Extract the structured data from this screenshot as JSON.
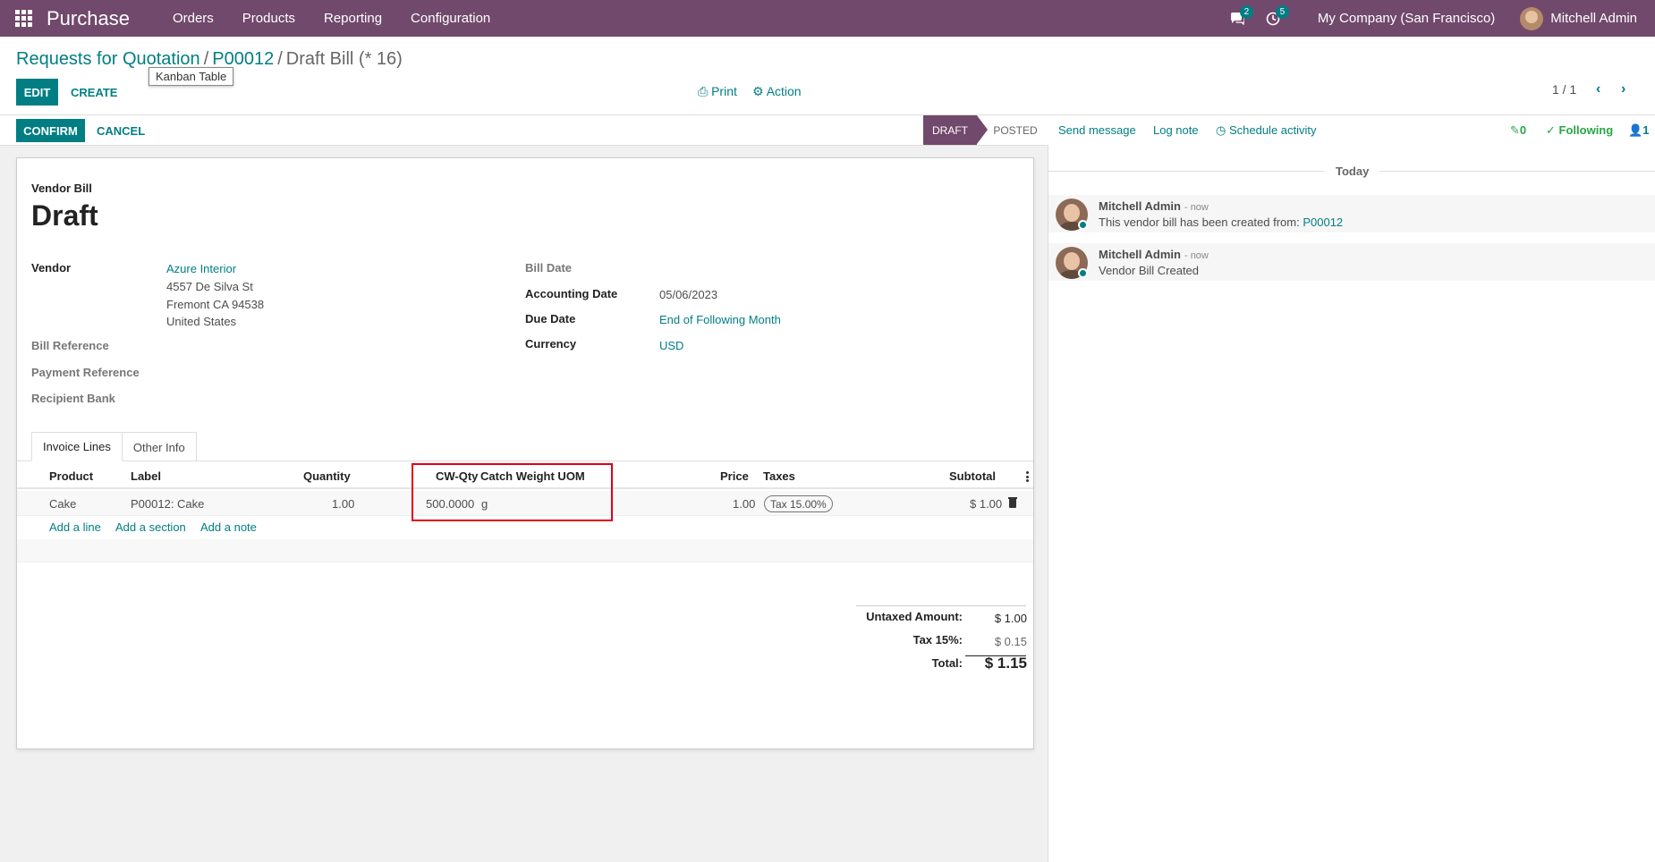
{
  "navbar": {
    "app_name": "Purchase",
    "menu": [
      "Orders",
      "Products",
      "Reporting",
      "Configuration"
    ],
    "messages_badge": "2",
    "activities_badge": "5",
    "company": "My Company (San Francisco)",
    "user": "Mitchell Admin"
  },
  "breadcrumb": {
    "items": [
      "Requests for Quotation",
      "P00012"
    ],
    "current": "Draft Bill (* 16)"
  },
  "control": {
    "edit_label": "EDIT",
    "create_label": "CREATE",
    "tooltip": "Kanban Table",
    "print_label": "Print",
    "action_label": "Action",
    "pager": "1 / 1"
  },
  "statusbar": {
    "confirm_label": "CONFIRM",
    "cancel_label": "CANCEL",
    "stages": [
      "DRAFT",
      "POSTED"
    ],
    "active_stage": "DRAFT"
  },
  "form": {
    "doc_type": "Vendor Bill",
    "title": "Draft",
    "vendor_label": "Vendor",
    "vendor_name": "Azure Interior",
    "vendor_address": [
      "4557 De Silva St",
      "Fremont CA 94538",
      "United States"
    ],
    "bill_reference_label": "Bill Reference",
    "payment_reference_label": "Payment Reference",
    "recipient_bank_label": "Recipient Bank",
    "bill_date_label": "Bill Date",
    "accounting_date_label": "Accounting Date",
    "accounting_date": "05/06/2023",
    "due_date_label": "Due Date",
    "due_date": "End of Following Month",
    "currency_label": "Currency",
    "currency": "USD"
  },
  "tabs": [
    "Invoice Lines",
    "Other Info"
  ],
  "invoice_lines": {
    "columns": [
      "Product",
      "Label",
      "Quantity",
      "CW-Qty",
      "Catch Weight UOM",
      "Price",
      "Taxes",
      "Subtotal"
    ],
    "rows": [
      {
        "product": "Cake",
        "label": "P00012: Cake",
        "quantity": "1.00",
        "cw_qty": "500.0000",
        "cw_uom": "g",
        "price": "1.00",
        "tax": "Tax 15.00%",
        "subtotal": "$ 1.00"
      }
    ],
    "add_line": "Add a line",
    "add_section": "Add a section",
    "add_note": "Add a note"
  },
  "totals": {
    "untaxed_label": "Untaxed Amount:",
    "untaxed_value": "$ 1.00",
    "tax_label": "Tax 15%:",
    "tax_value": "$ 0.15",
    "total_label": "Total:",
    "total_value": "$ 1.15"
  },
  "chatter": {
    "send_message": "Send message",
    "log_note": "Log note",
    "schedule_activity": "Schedule activity",
    "attachments": "0",
    "following": "Following",
    "followers": "1",
    "today": "Today",
    "messages": [
      {
        "author": "Mitchell Admin",
        "time": "- now",
        "body_prefix": "This vendor bill has been created from: ",
        "body_link": "P00012"
      },
      {
        "author": "Mitchell Admin",
        "time": "- now",
        "body_prefix": "Vendor Bill Created",
        "body_link": ""
      }
    ]
  },
  "colors": {
    "navbar": "#71496c",
    "primary": "#017e84",
    "highlight_border": "#e0001a"
  }
}
